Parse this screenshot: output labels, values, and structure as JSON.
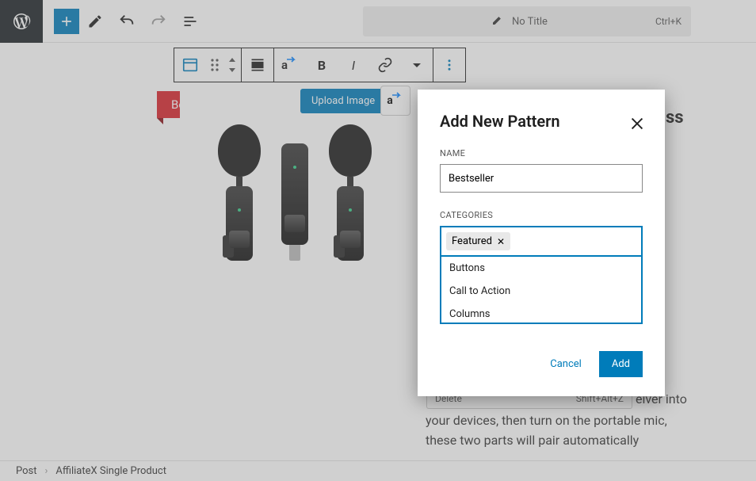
{
  "topbar": {
    "title_placeholder": "No Title",
    "shortcut": "Ctrl+K"
  },
  "ribbon": {
    "label": "Bestseller"
  },
  "upload_button": "Upload Image",
  "right_peek": "ss",
  "delete_menu": {
    "label": "Delete",
    "shortcut": "Shift+Alt+Z"
  },
  "body_copy": "your devices, then turn on the portable mic, these two parts will pair automatically",
  "body_copy_tail": "eiver into",
  "breadcrumb": {
    "root": "Post",
    "current": "AffiliateX Single Product"
  },
  "modal": {
    "title": "Add New Pattern",
    "name_label": "Name",
    "name_value": "Bestseller",
    "categories_label": "Categories",
    "selected_token": "Featured",
    "options": [
      "Buttons",
      "Call to Action",
      "Columns"
    ],
    "cancel": "Cancel",
    "add": "Add"
  }
}
